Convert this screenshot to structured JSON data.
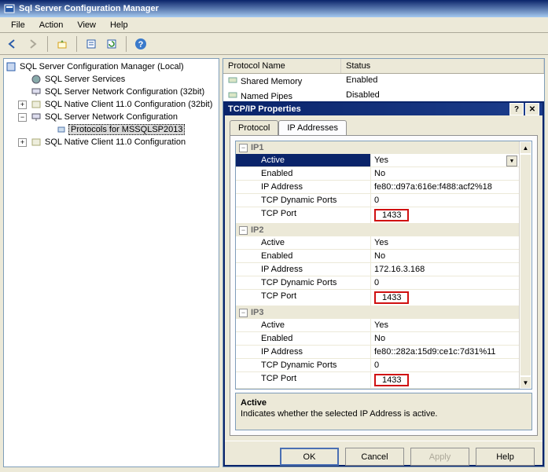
{
  "window": {
    "title": "Sql Server Configuration Manager"
  },
  "menu": {
    "file": "File",
    "action": "Action",
    "view": "View",
    "help": "Help"
  },
  "tree": {
    "root": "SQL Server Configuration Manager (Local)",
    "i1": "SQL Server Services",
    "i2": "SQL Server Network Configuration (32bit)",
    "i3": "SQL Native Client 11.0 Configuration (32bit)",
    "i4": "SQL Server Network Configuration",
    "i4a": "Protocols for MSSQLSP2013",
    "i5": "SQL Native Client 11.0 Configuration"
  },
  "list": {
    "col1": "Protocol Name",
    "col2": "Status",
    "r1n": "Shared Memory",
    "r1s": "Enabled",
    "r2n": "Named Pipes",
    "r2s": "Disabled"
  },
  "dialog": {
    "title": "TCP/IP Properties",
    "tab1": "Protocol",
    "tab2": "IP Addresses",
    "cat_ip1": "IP1",
    "cat_ip2": "IP2",
    "cat_ip3": "IP3",
    "k_active": "Active",
    "k_enabled": "Enabled",
    "k_ipaddr": "IP Address",
    "k_tcpdyn": "TCP Dynamic Ports",
    "k_tcpport": "TCP Port",
    "ip1": {
      "active": "Yes",
      "enabled": "No",
      "addr": "fe80::d97a:616e:f488:acf2%18",
      "dyn": "0",
      "port": "1433"
    },
    "ip2": {
      "active": "Yes",
      "enabled": "No",
      "addr": "172.16.3.168",
      "dyn": "0",
      "port": "1433"
    },
    "ip3": {
      "active": "Yes",
      "enabled": "No",
      "addr": "fe80::282a:15d9:ce1c:7d31%11",
      "dyn": "0",
      "port": "1433"
    },
    "desc_title": "Active",
    "desc_text": "Indicates whether the selected IP Address is active.",
    "btn_ok": "OK",
    "btn_cancel": "Cancel",
    "btn_apply": "Apply",
    "btn_help": "Help"
  }
}
